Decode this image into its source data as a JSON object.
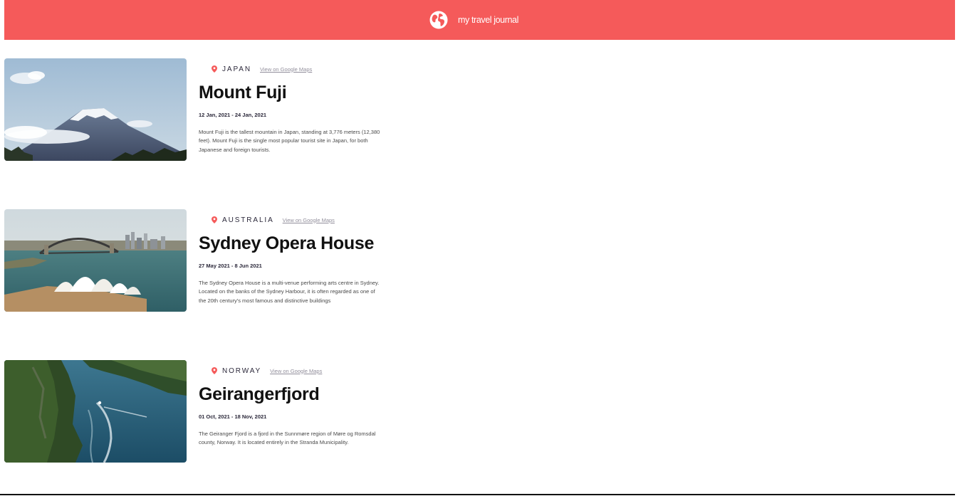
{
  "header": {
    "title": "my travel journal",
    "logo_icon": "globe-icon",
    "background": "#F55A5A"
  },
  "entries": [
    {
      "country": "JAPAN",
      "maps_link": "View on Google Maps",
      "title": "Mount Fuji",
      "dates": "12 Jan, 2021 - 24 Jan, 2021",
      "description": "Mount Fuji is the tallest mountain in Japan, standing at 3,776 meters (12,380 feet). Mount Fuji is the single most popular tourist site in Japan, for both Japanese and foreign tourists.",
      "image": "mount-fuji-photo"
    },
    {
      "country": "AUSTRALIA",
      "maps_link": "View on Google Maps",
      "title": "Sydney Opera House",
      "dates": "27 May 2021 - 8 Jun 2021",
      "description": "The Sydney Opera House is a multi-venue performing arts centre in Sydney. Located on the banks of the Sydney Harbour, it is often regarded as one of the 20th century's most famous and distinctive buildings",
      "image": "sydney-opera-house-photo"
    },
    {
      "country": "NORWAY",
      "maps_link": "View on Google Maps",
      "title": "Geirangerfjord",
      "dates": "01 Oct, 2021 - 18 Nov, 2021",
      "description": "The Geiranger Fjord is a fjord in the Sunnmøre region of Møre og Romsdal county, Norway. It is located entirely in the Stranda Municipality.",
      "image": "geirangerfjord-photo"
    }
  ],
  "colors": {
    "accent": "#F55A5A",
    "text_dark": "#2B283A",
    "link_gray": "#918E9B"
  }
}
